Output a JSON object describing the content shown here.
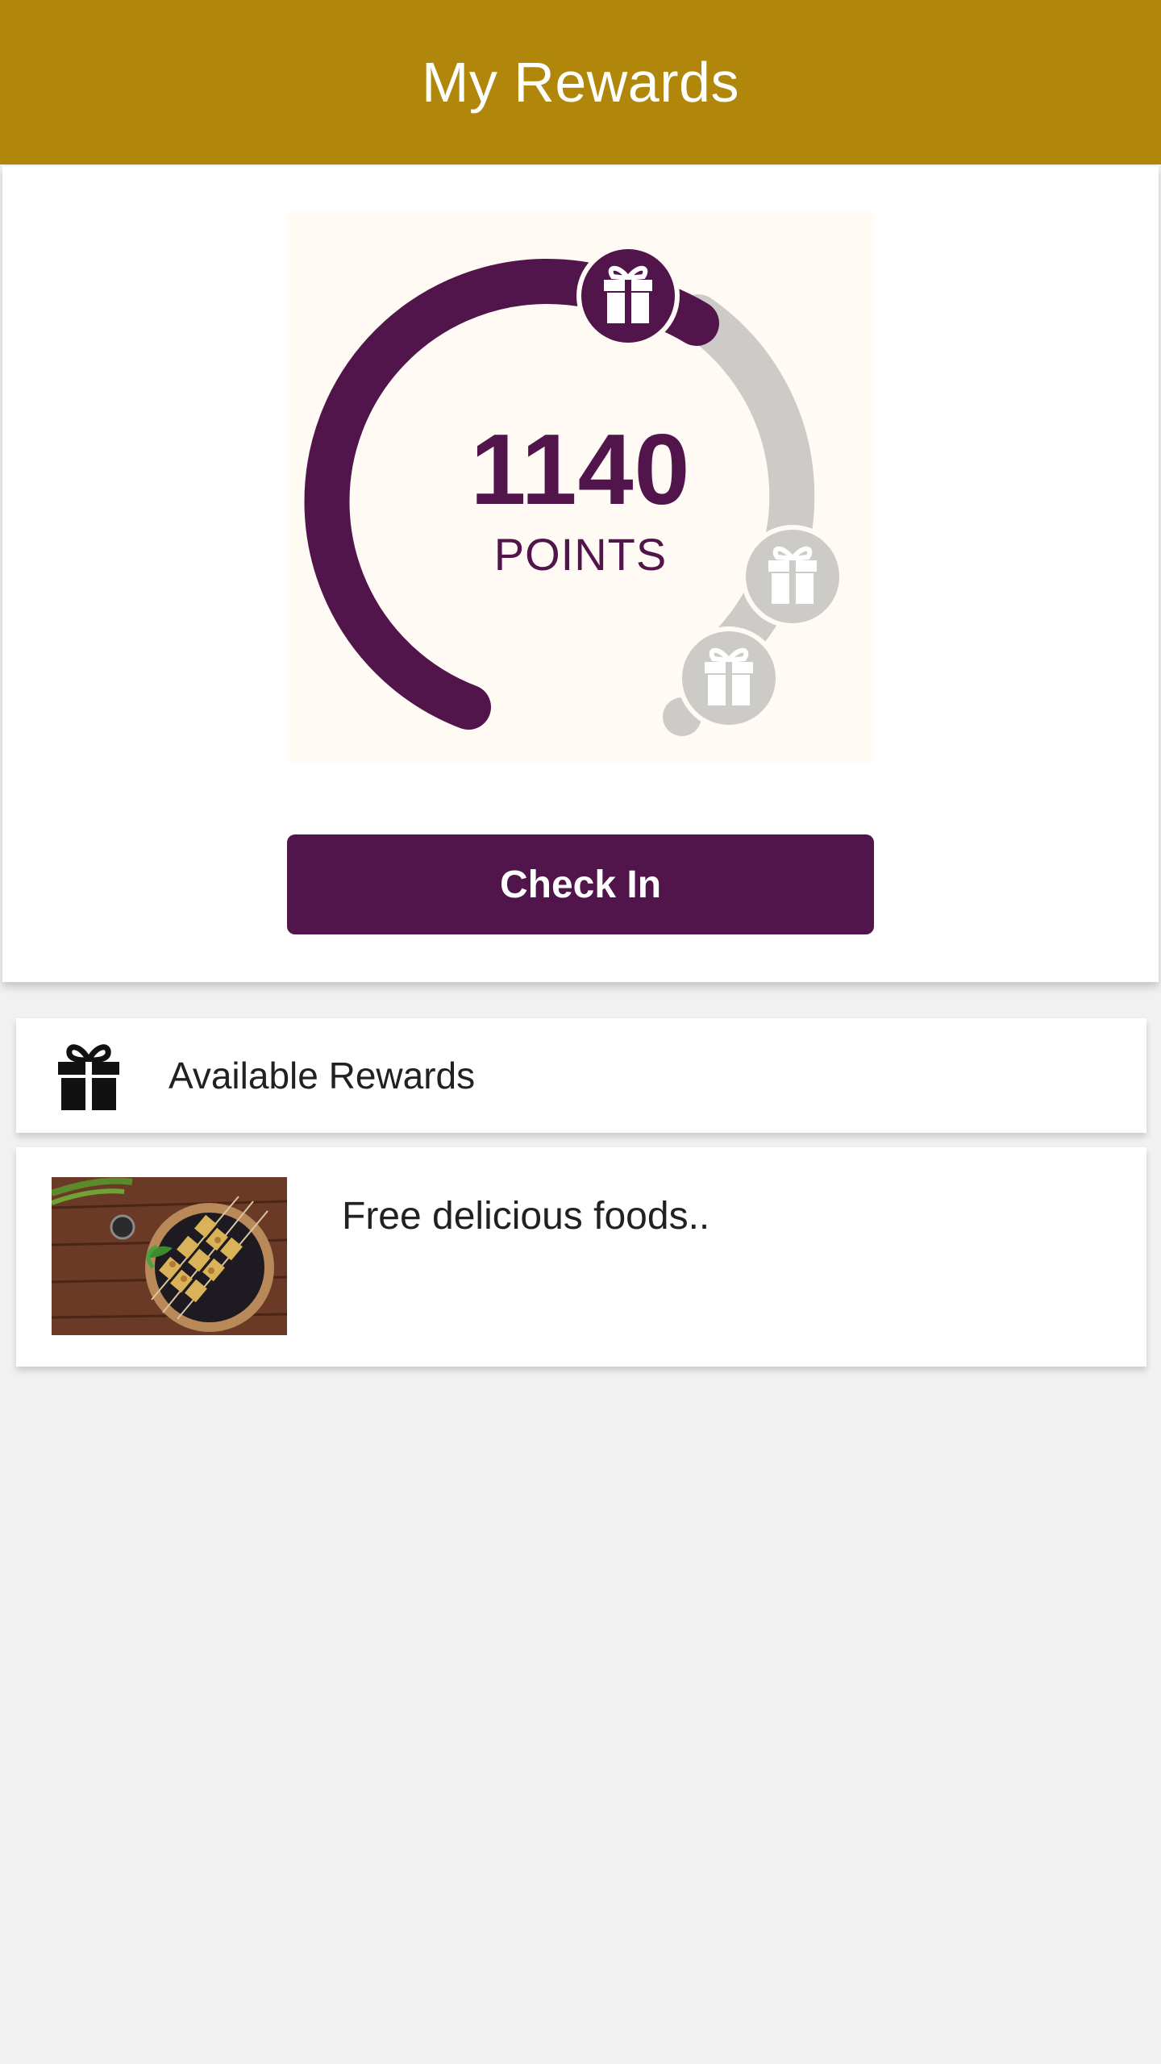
{
  "app": {
    "title": "My Rewards",
    "accent_color": "#b0870a",
    "brand_color": "#51144b"
  },
  "points": {
    "value": "1140",
    "label": "POINTS",
    "progress_fraction": 0.62
  },
  "actions": {
    "checkin_label": "Check In"
  },
  "rewards_section": {
    "header_label": "Available Rewards",
    "icon": "gift-icon"
  },
  "rewards": [
    {
      "title": "Free delicious foods..",
      "thumbnail": "food-skewers-image"
    }
  ]
}
